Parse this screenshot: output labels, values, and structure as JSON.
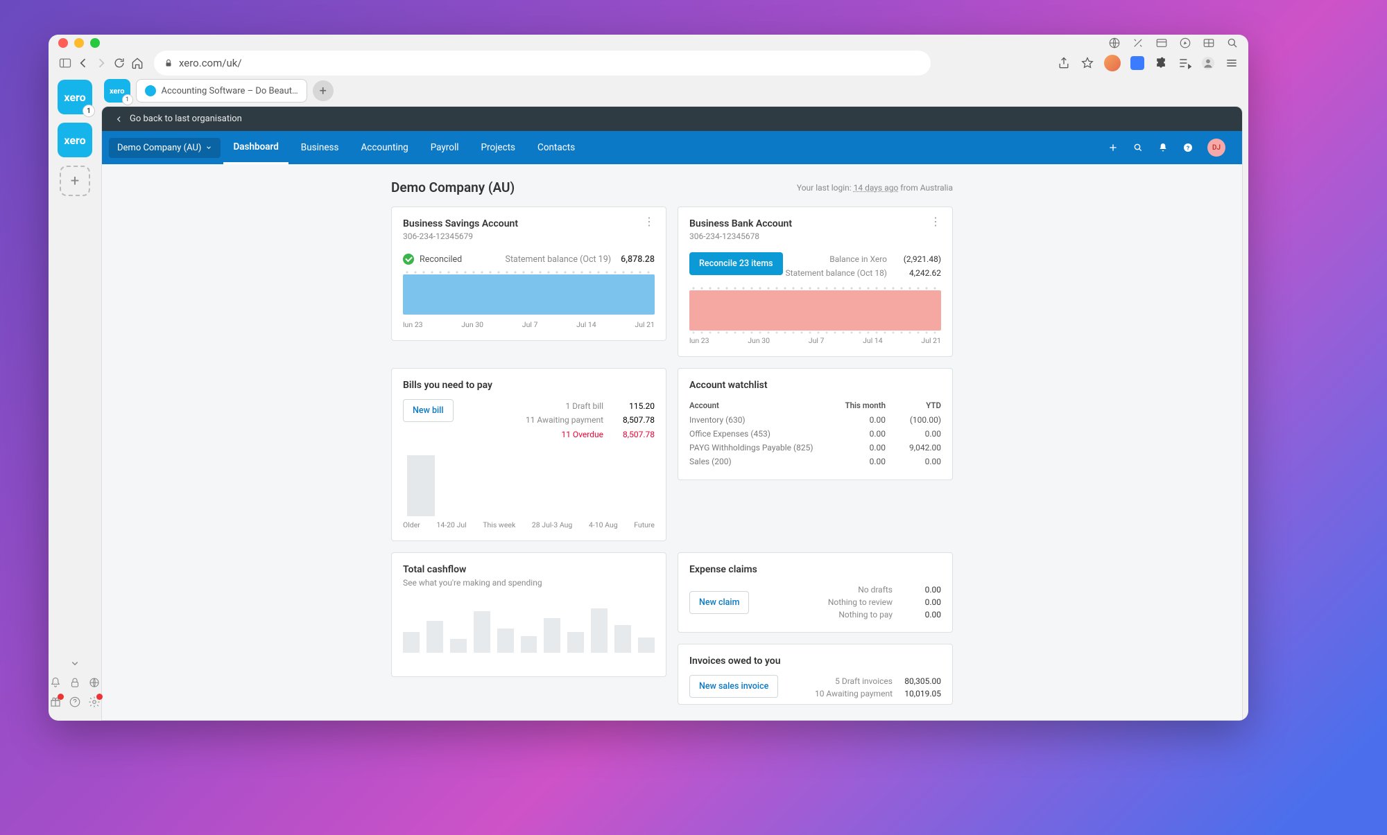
{
  "browser": {
    "url": "xero.com/uk/",
    "tab_title": "Accounting Software – Do Beaut…",
    "rail_badge": "1",
    "rail_pill_badge": "1"
  },
  "app": {
    "back_link": "Go back to last organisation",
    "org_name": "Demo Company (AU)",
    "nav": {
      "dashboard": "Dashboard",
      "business": "Business",
      "accounting": "Accounting",
      "payroll": "Payroll",
      "projects": "Projects",
      "contacts": "Contacts"
    },
    "profile_initials": "DJ",
    "page_title": "Demo Company (AU)",
    "login_prefix": "Your last login: ",
    "login_time": "14 days ago",
    "login_suffix": " from Australia"
  },
  "savings": {
    "title": "Business Savings Account",
    "number": "306-234-12345679",
    "status": "Reconciled",
    "stmt_label": "Statement balance (Oct 19)",
    "stmt_value": "6,878.28",
    "xlabels": {
      "a": "lun 23",
      "b": "Jun 30",
      "c": "Jul 7",
      "d": "Jul 14",
      "e": "Jul 21"
    }
  },
  "bank": {
    "title": "Business Bank Account",
    "number": "306-234-12345678",
    "button": "Reconcile 23 items",
    "l1": "Balance in Xero",
    "v1": "(2,921.48)",
    "l2": "Statement balance (Oct 18)",
    "v2": "4,242.62",
    "xlabels": {
      "a": "lun 23",
      "b": "Jun 30",
      "c": "Jul 7",
      "d": "Jul 14",
      "e": "Jul 21"
    }
  },
  "bills": {
    "title": "Bills you need to pay",
    "button": "New bill",
    "r1l": "1 Draft bill",
    "r1v": "115.20",
    "r2l": "11 Awaiting payment",
    "r2v": "8,507.78",
    "r3l": "11 Overdue",
    "r3v": "8,507.78",
    "xl": {
      "a": "Older",
      "b": "14-20 Jul",
      "c": "This week",
      "d": "28 Jul-3 Aug",
      "e": "4-10 Aug",
      "f": "Future"
    }
  },
  "watchlist": {
    "title": "Account watchlist",
    "col1": "Account",
    "col2": "This month",
    "col3": "YTD",
    "r1": {
      "a": "Inventory (630)",
      "b": "0.00",
      "c": "(100.00)"
    },
    "r2": {
      "a": "Office Expenses (453)",
      "b": "0.00",
      "c": "0.00"
    },
    "r3": {
      "a": "PAYG Withholdings Payable (825)",
      "b": "0.00",
      "c": "9,042.00"
    },
    "r4": {
      "a": "Sales (200)",
      "b": "0.00",
      "c": "0.00"
    }
  },
  "expense": {
    "title": "Expense claims",
    "button": "New claim",
    "r1l": "No drafts",
    "r1v": "0.00",
    "r2l": "Nothing to review",
    "r2v": "0.00",
    "r3l": "Nothing to pay",
    "r3v": "0.00"
  },
  "cashflow": {
    "title": "Total cashflow",
    "sub": "See what you're making and spending"
  },
  "invoices": {
    "title": "Invoices owed to you",
    "button": "New sales invoice",
    "r1l": "5 Draft invoices",
    "r1v": "80,305.00",
    "r2l": "10 Awaiting payment",
    "r2v": "10,019.05"
  }
}
